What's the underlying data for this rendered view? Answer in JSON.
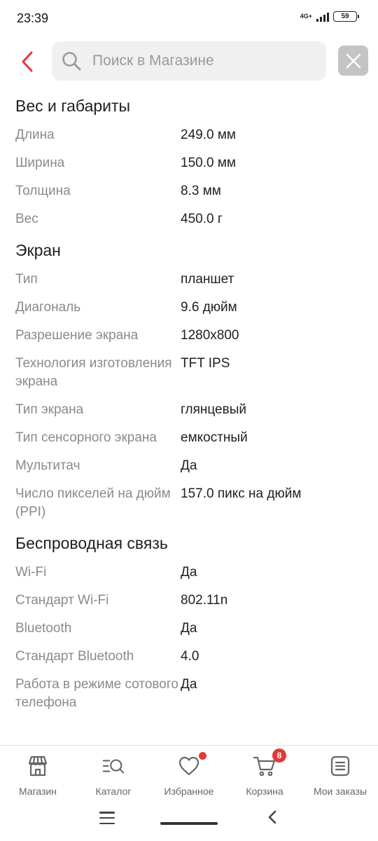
{
  "status_bar": {
    "time": "23:39",
    "network": "4G+",
    "battery": "59"
  },
  "header": {
    "search_placeholder": "Поиск в Магазине"
  },
  "sections": [
    {
      "title": "Вес и габариты",
      "rows": [
        {
          "label": "Длина",
          "value": "249.0 мм"
        },
        {
          "label": "Ширина",
          "value": "150.0 мм"
        },
        {
          "label": "Толщина",
          "value": "8.3 мм"
        },
        {
          "label": "Вес",
          "value": "450.0 г"
        }
      ]
    },
    {
      "title": "Экран",
      "rows": [
        {
          "label": "Тип",
          "value": "планшет"
        },
        {
          "label": "Диагональ",
          "value": "9.6 дюйм"
        },
        {
          "label": "Разрешение экрана",
          "value": "1280x800"
        },
        {
          "label": "Технология изготовления экрана",
          "value": "TFT IPS"
        },
        {
          "label": "Тип экрана",
          "value": "глянцевый"
        },
        {
          "label": "Тип сенсорного экрана",
          "value": "емкостный"
        },
        {
          "label": "Мультитач",
          "value": "Да"
        },
        {
          "label": "Число пикселей на дюйм (PPI)",
          "value": "157.0 пикс на дюйм"
        }
      ]
    },
    {
      "title": "Беспроводная связь",
      "rows": [
        {
          "label": "Wi-Fi",
          "value": "Да"
        },
        {
          "label": "Стандарт Wi-Fi",
          "value": "802.11n"
        },
        {
          "label": "Bluetooth",
          "value": "Да"
        },
        {
          "label": "Стандарт Bluetooth",
          "value": "4.0"
        },
        {
          "label": "Работа в режиме сотового телефона",
          "value": "Да"
        }
      ]
    }
  ],
  "bottom_nav": [
    {
      "label": "Магазин",
      "icon": "store-icon"
    },
    {
      "label": "Каталог",
      "icon": "catalog-search-icon"
    },
    {
      "label": "Избранное",
      "icon": "heart-icon",
      "badge_dot": true
    },
    {
      "label": "Корзина",
      "icon": "cart-icon",
      "badge_count": "8"
    },
    {
      "label": "Мои заказы",
      "icon": "orders-icon"
    }
  ],
  "colors": {
    "accent": "#e53935",
    "label_gray": "#8a8a8a",
    "text": "#1f1f1f"
  }
}
